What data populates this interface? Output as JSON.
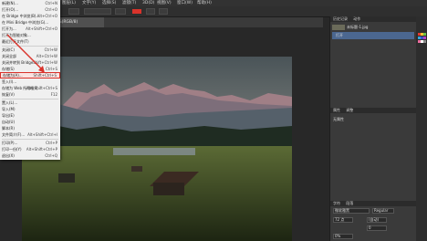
{
  "menubar": {
    "items": [
      "文件(F)",
      "编辑(E)",
      "图像(I)",
      "图层(L)",
      "文字(Y)",
      "选择(S)",
      "滤镜(T)",
      "3D(D)",
      "视图(V)",
      "窗口(W)",
      "帮助(H)"
    ]
  },
  "document": {
    "tab_title": "未标题-1 @ 16.7%(RGB/8)"
  },
  "menu": {
    "items": [
      {
        "label": "新建(N)...",
        "shortcut": "Ctrl+N"
      },
      {
        "label": "打开(O)...",
        "shortcut": "Ctrl+O"
      },
      {
        "label": "在 Bridge 中浏览(B)...",
        "shortcut": "Alt+Ctrl+O"
      },
      {
        "label": "在 Mini Bridge 中浏览(G)...",
        "shortcut": ""
      },
      {
        "label": "打开为...",
        "shortcut": "Alt+Shift+Ctrl+O"
      },
      {
        "label": "打开为智能对象...",
        "shortcut": ""
      },
      {
        "label": "最近打开文件(T)",
        "shortcut": ""
      },
      {
        "label": "关闭(C)",
        "shortcut": "Ctrl+W"
      },
      {
        "label": "关闭全部",
        "shortcut": "Alt+Ctrl+W"
      },
      {
        "label": "关闭并转到 Bridge...",
        "shortcut": "Shift+Ctrl+W"
      },
      {
        "label": "存储(S)",
        "shortcut": "Ctrl+S"
      },
      {
        "label": "存储为(A)...",
        "shortcut": "Shift+Ctrl+S"
      },
      {
        "label": "签入(I)...",
        "shortcut": ""
      },
      {
        "label": "存储为 Web 所用格式...",
        "shortcut": "Alt+Shift+Ctrl+S"
      },
      {
        "label": "恢复(V)",
        "shortcut": "F12"
      },
      {
        "label": "置入(L)...",
        "shortcut": ""
      },
      {
        "label": "导入(M)",
        "shortcut": ""
      },
      {
        "label": "导出(E)",
        "shortcut": ""
      },
      {
        "label": "自动(U)",
        "shortcut": ""
      },
      {
        "label": "脚本(R)",
        "shortcut": ""
      },
      {
        "label": "文件简介(F)...",
        "shortcut": "Alt+Shift+Ctrl+I"
      },
      {
        "label": "打印(P)...",
        "shortcut": "Ctrl+P"
      },
      {
        "label": "打印一份(Y)",
        "shortcut": "Alt+Shift+Ctrl+P"
      },
      {
        "label": "退出(X)",
        "shortcut": "Ctrl+Q"
      }
    ],
    "highlighted_index": 11
  },
  "history_panel": {
    "tabs": [
      "历史记录",
      "动作"
    ],
    "snapshot": "未标题-1.jpg",
    "items": [
      "打开"
    ]
  },
  "properties_panel": {
    "tabs": [
      "属性",
      "调整"
    ],
    "label": "无属性"
  },
  "character_panel": {
    "tabs": [
      "字符",
      "段落"
    ],
    "font_family": "微软雅黑",
    "font_style": "Regular",
    "size": "72 点",
    "leading": "(自动)",
    "tracking": "0",
    "scale": "0%"
  },
  "colors": {
    "accent": "#d9332b",
    "selection": "#4b6790"
  }
}
